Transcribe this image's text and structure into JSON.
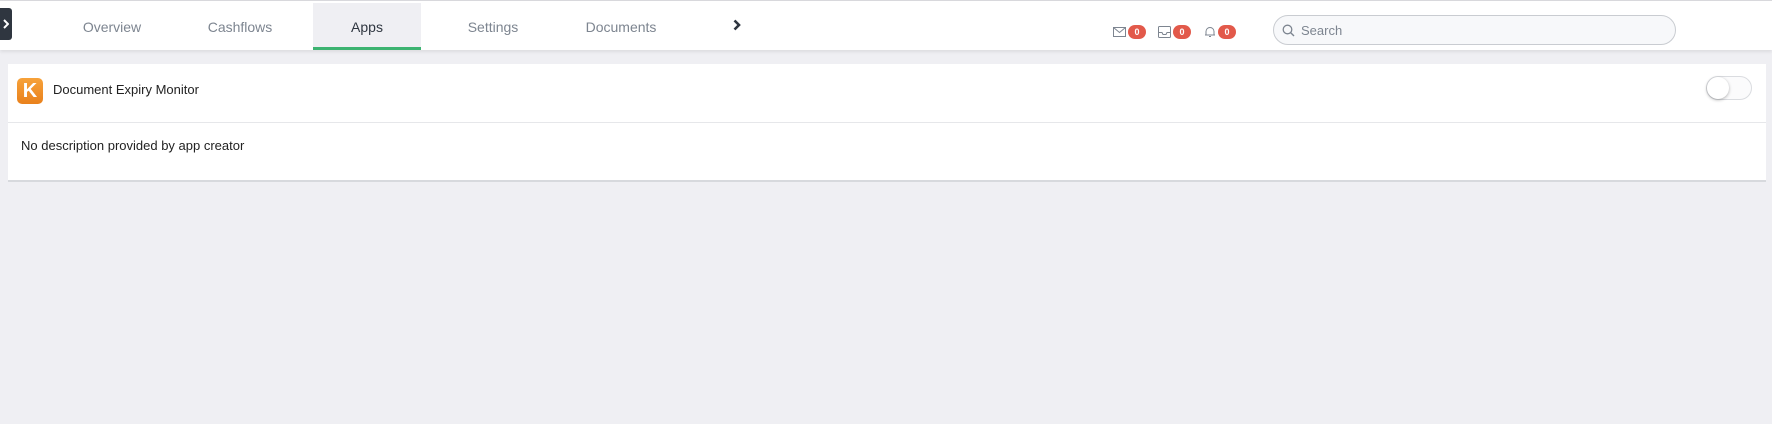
{
  "nav": {
    "tabs": [
      {
        "label": "Overview",
        "active": false
      },
      {
        "label": "Cashflows",
        "active": false
      },
      {
        "label": "Apps",
        "active": true
      },
      {
        "label": "Settings",
        "active": false
      },
      {
        "label": "Documents",
        "active": false
      }
    ],
    "more_icon": "chevron-right-icon",
    "sidebar_toggle_icon": "chevron-right-icon"
  },
  "notifications": {
    "messages": {
      "icon": "mail-icon",
      "count": "0"
    },
    "inbox": {
      "icon": "inbox-icon",
      "count": "0"
    },
    "alerts": {
      "icon": "bell-icon",
      "count": "0"
    }
  },
  "search": {
    "placeholder": "Search",
    "value": ""
  },
  "app": {
    "logo_letter": "K",
    "name": "Document Expiry Monitor",
    "enabled": false,
    "description": "No description provided by app creator"
  },
  "colors": {
    "accent": "#3cb371",
    "badge": "#e2594a",
    "logo": "#f08c22",
    "background": "#efeff3"
  }
}
